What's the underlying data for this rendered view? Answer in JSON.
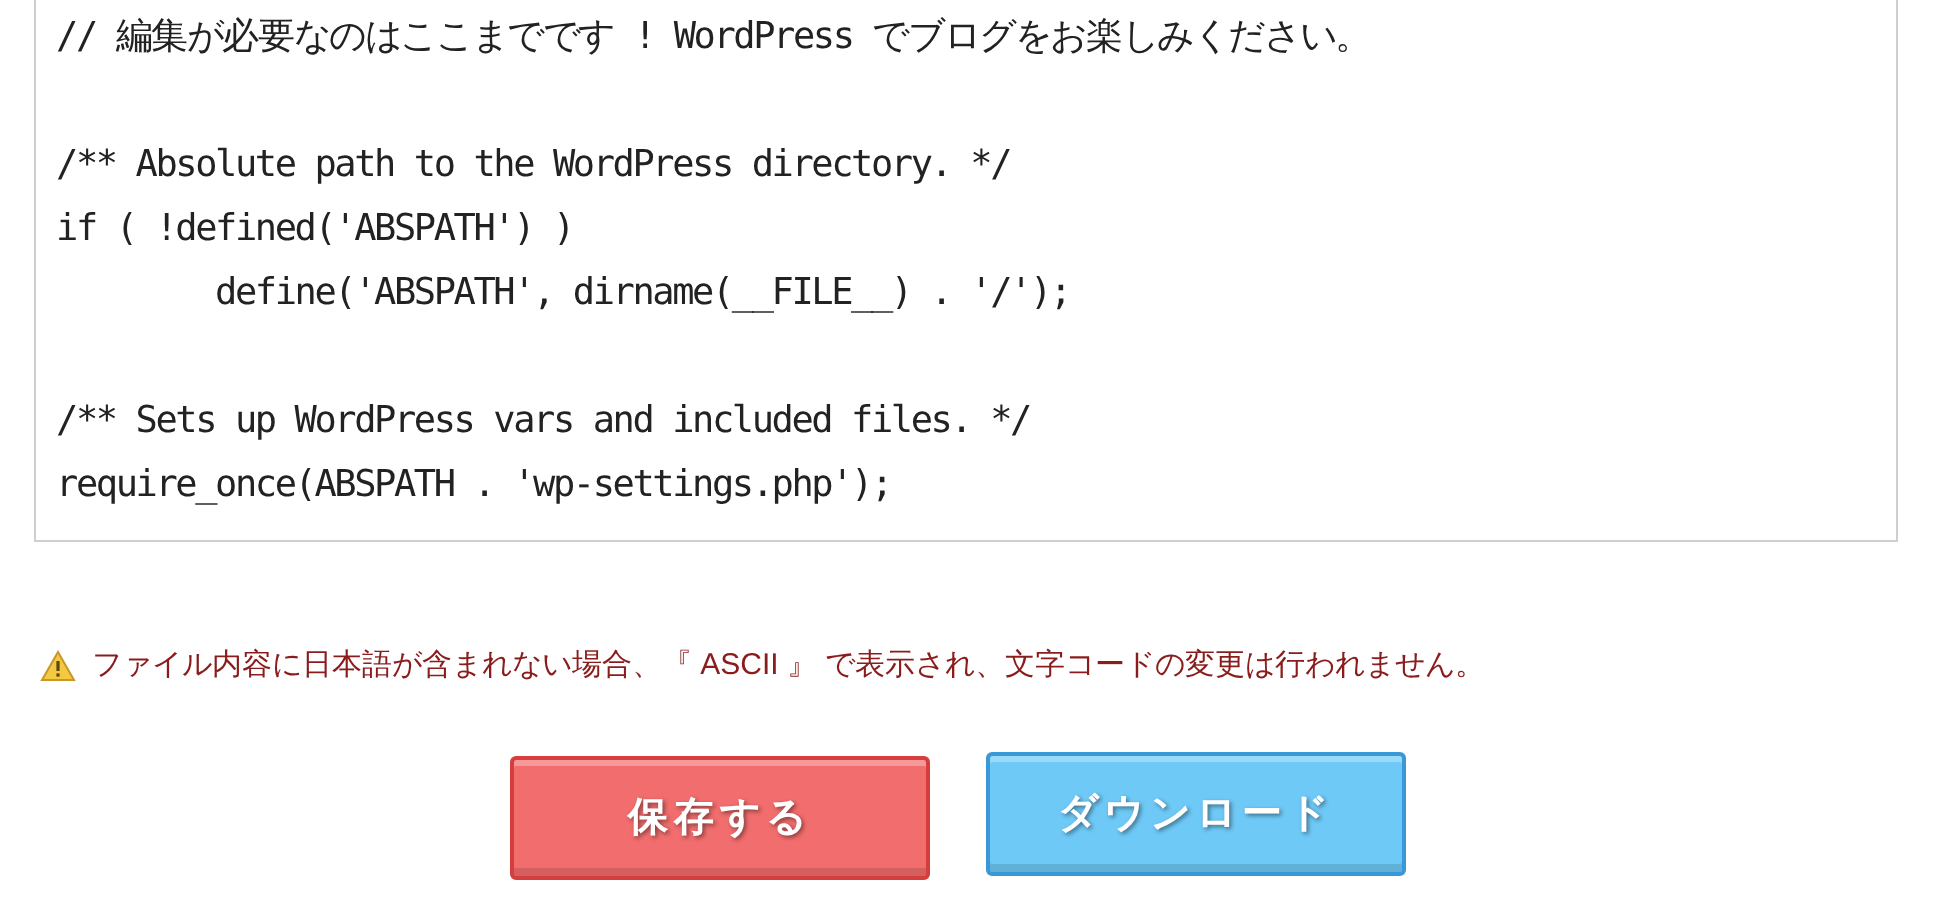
{
  "code_editor": {
    "blocks": [
      [
        "// 編集が必要なのはここまでです ! WordPress でブログをお楽しみください。"
      ],
      [
        "/** Absolute path to the WordPress directory. */",
        "if ( !defined('ABSPATH') )",
        "        define('ABSPATH', dirname(__FILE__) . '/');"
      ],
      [
        "/** Sets up WordPress vars and included files. */",
        "require_once(ABSPATH . 'wp-settings.php');"
      ]
    ]
  },
  "notice": {
    "kind": "warning",
    "text": "ファイル内容に日本語が含まれない場合、『 ASCII 』 で表示され、文字コードの変更は行われません。"
  },
  "buttons": [
    {
      "kind": "save",
      "label": "保存する"
    },
    {
      "kind": "download",
      "label": "ダウンロード"
    }
  ]
}
